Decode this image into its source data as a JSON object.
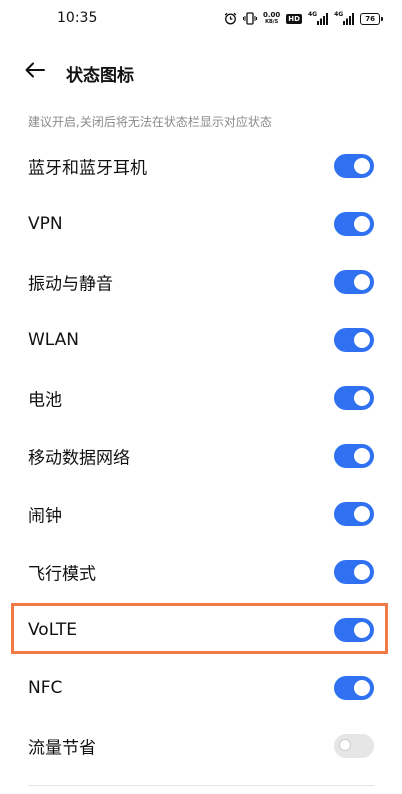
{
  "status_bar": {
    "time": "10:35",
    "icons": [
      "alarm-icon",
      "vibrate-icon",
      "network-speed",
      "hd-icon",
      "4g-signal-icon",
      "4g-signal-icon",
      "battery-icon"
    ],
    "net_speed_value": "0.00",
    "net_speed_unit": "KB/S",
    "hd_label": "HD",
    "net_label_1": "4G",
    "net_label_2": "4G",
    "battery_level": "76"
  },
  "header": {
    "back_icon": "arrow-left-icon",
    "title": "状态图标"
  },
  "hint": "建议开启,关闭后将无法在状态栏显示对应状态",
  "settings": [
    {
      "label": "蓝牙和蓝牙耳机",
      "enabled": true
    },
    {
      "label": "VPN",
      "enabled": true
    },
    {
      "label": "振动与静音",
      "enabled": true
    },
    {
      "label": "WLAN",
      "enabled": true
    },
    {
      "label": "电池",
      "enabled": true
    },
    {
      "label": "移动数据网络",
      "enabled": true
    },
    {
      "label": "闹钟",
      "enabled": true
    },
    {
      "label": "飞行模式",
      "enabled": true
    },
    {
      "label": "VoLTE",
      "enabled": true,
      "highlighted": true
    },
    {
      "label": "NFC",
      "enabled": true
    },
    {
      "label": "流量节省",
      "enabled": false,
      "disabled": true
    }
  ],
  "colors": {
    "toggle_on": "#2f71f0",
    "toggle_off": "#e6e6e6",
    "highlight": "#f07a45"
  }
}
